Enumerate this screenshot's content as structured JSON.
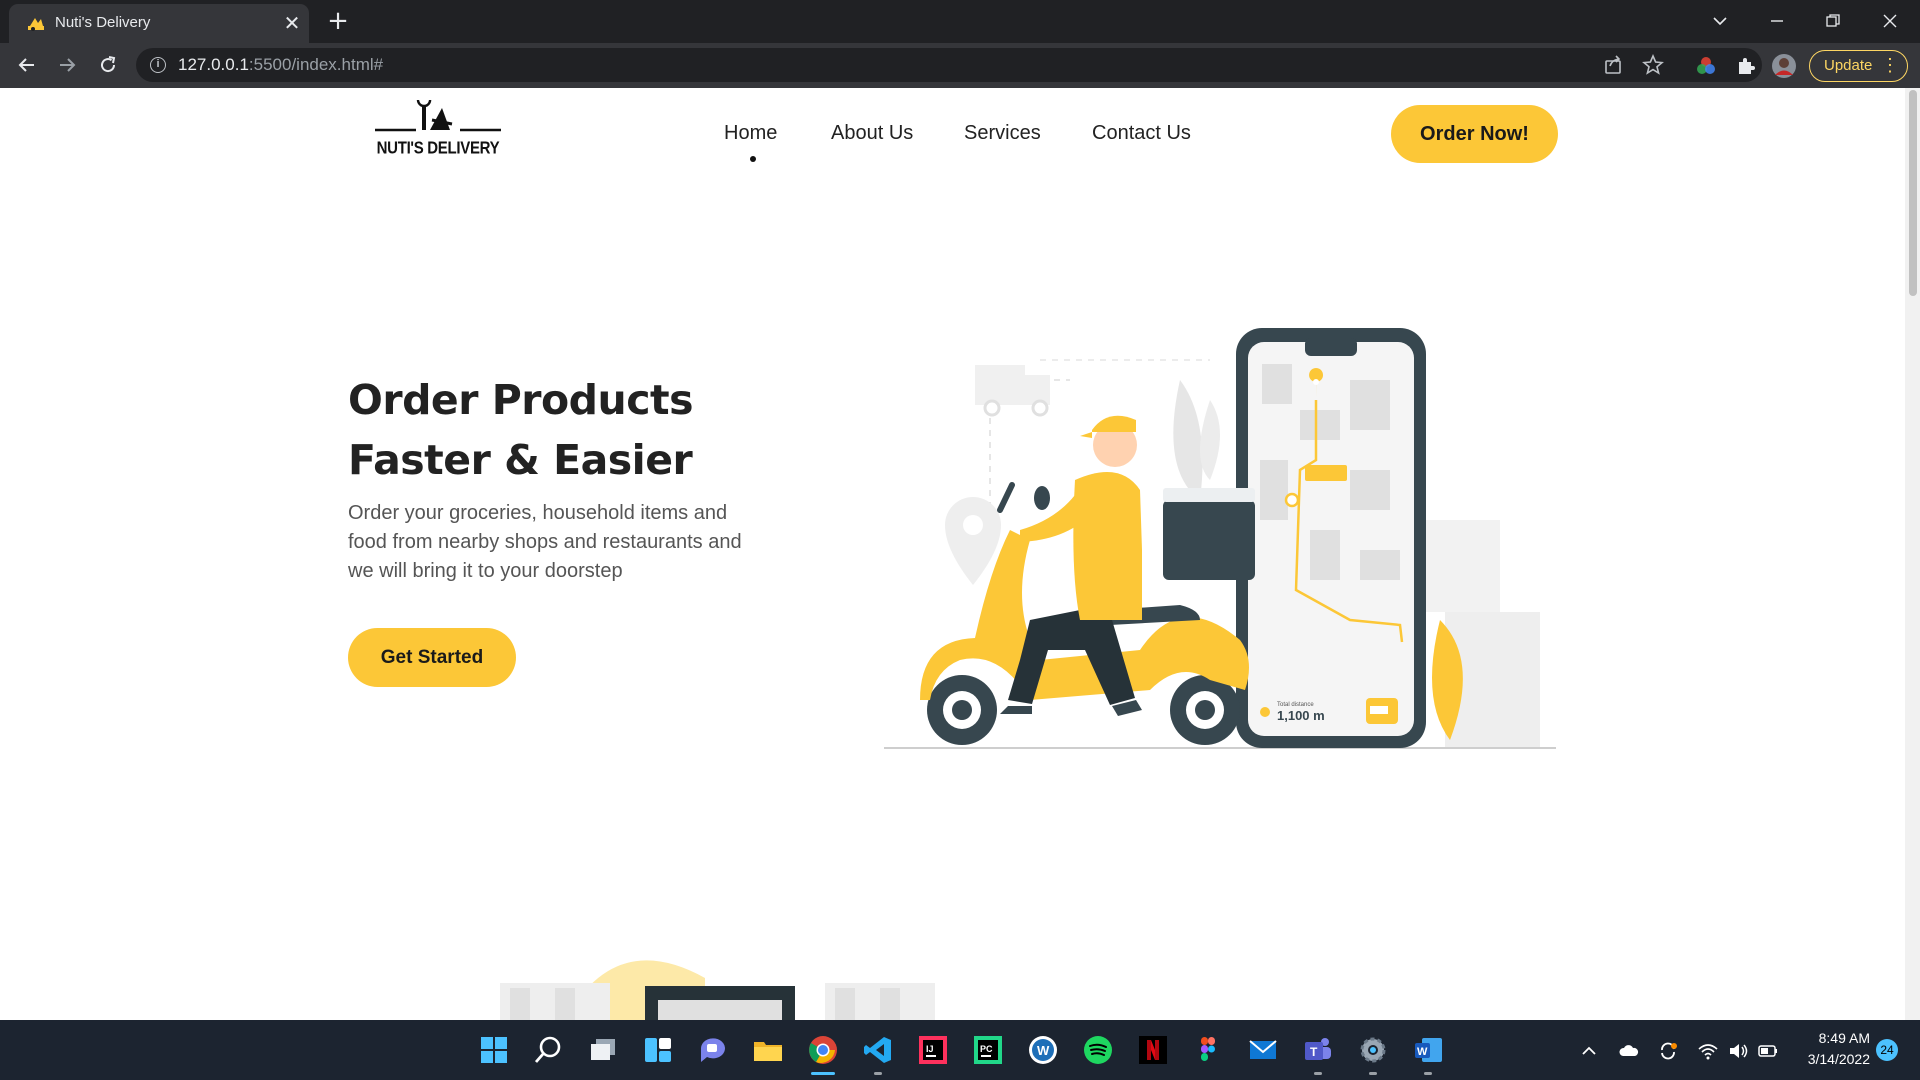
{
  "browser": {
    "tab_title": "Nuti's Delivery",
    "tab_close": "✕",
    "new_tab": "+",
    "url_host": "127.0.0.1",
    "url_rest": ":5500/index.html#",
    "update_label": "Update"
  },
  "site": {
    "logo_text": "NUTI'S DELIVERY",
    "nav": [
      {
        "label": "Home"
      },
      {
        "label": "About Us"
      },
      {
        "label": "Services"
      },
      {
        "label": "Contact Us"
      }
    ],
    "order_button": "Order Now!",
    "hero": {
      "title_line1": "Order Products",
      "title_line2": "Faster & Easier",
      "subtitle": "Order your groceries, household items and food from nearby shops and restaurants and we will bring it to your doorstep",
      "cta": "Get Started"
    },
    "illustration": {
      "distance_label": "Total distance",
      "distance_value": "1,100 m"
    }
  },
  "taskbar": {
    "time": "8:49 AM",
    "date": "3/14/2022",
    "notifications": "24"
  },
  "colors": {
    "accent": "#fcc737",
    "dark": "#37474f",
    "chrome_bg": "#202124",
    "toolbar_bg": "#35363a"
  }
}
